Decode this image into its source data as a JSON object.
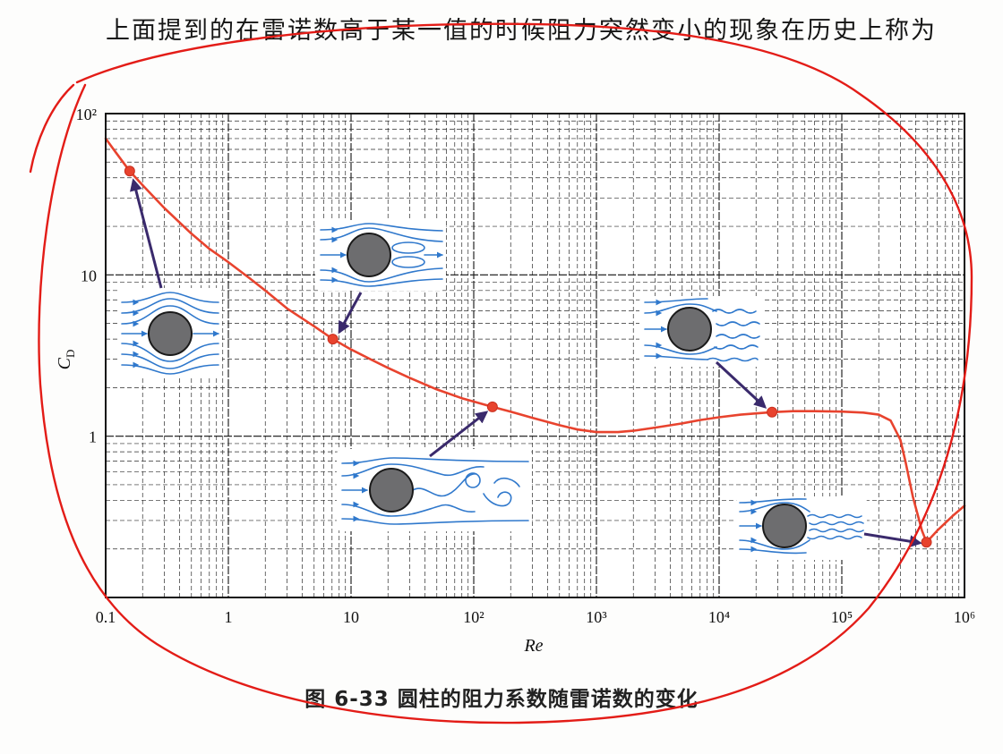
{
  "page": {
    "top_text": "上面提到的在雷诺数高于某一值的时候阻力突然变小的现象在历史上称为",
    "caption": "图 6-33  圆柱的阻力系数随雷诺数的变化"
  },
  "chart_data": {
    "type": "line",
    "xlabel": "Re",
    "ylabel": "C",
    "ylabel_subscript": "D",
    "xscale": "log",
    "yscale": "log",
    "xlim": [
      0.1,
      1000000
    ],
    "ylim": [
      0.1,
      100
    ],
    "grid": true,
    "x_ticks": [
      {
        "value": 0.1,
        "label": "0.1"
      },
      {
        "value": 1,
        "label": "1"
      },
      {
        "value": 10,
        "label": "10"
      },
      {
        "value": 100,
        "label": "10²"
      },
      {
        "value": 1000,
        "label": "10³"
      },
      {
        "value": 10000,
        "label": "10⁴"
      },
      {
        "value": 100000,
        "label": "10⁵"
      },
      {
        "value": 1000000,
        "label": "10⁶"
      }
    ],
    "y_ticks": [
      {
        "value": 1,
        "label": "1"
      },
      {
        "value": 10,
        "label": "10"
      },
      {
        "value": 100,
        "label": "10²"
      }
    ],
    "series": [
      {
        "color": "#e8432e",
        "x": [
          0.1,
          0.12,
          0.157,
          0.2,
          0.3,
          0.5,
          0.7,
          1,
          1.5,
          2,
          3,
          5,
          7.1,
          10,
          15,
          20,
          30,
          50,
          80,
          142,
          200,
          300,
          500,
          700,
          1000,
          1500,
          2000,
          3000,
          5000,
          7000,
          10000,
          15000,
          27000,
          40000,
          60000,
          100000,
          150000,
          200000,
          250000,
          300000,
          330000,
          380000,
          450000,
          490000,
          600000,
          800000,
          1000000
        ],
        "y": [
          70,
          58,
          44,
          36,
          26,
          18,
          14.5,
          12,
          9.5,
          8,
          6.2,
          4.8,
          4.0,
          3.45,
          2.95,
          2.65,
          2.3,
          1.95,
          1.72,
          1.52,
          1.42,
          1.3,
          1.17,
          1.1,
          1.06,
          1.06,
          1.08,
          1.13,
          1.2,
          1.26,
          1.31,
          1.36,
          1.41,
          1.43,
          1.43,
          1.42,
          1.4,
          1.36,
          1.25,
          0.95,
          0.7,
          0.42,
          0.26,
          0.22,
          0.26,
          0.32,
          0.37
        ]
      }
    ],
    "highlighted_points": {
      "color": "#e8432e",
      "x": [
        0.157,
        7.1,
        142,
        27000,
        490000
      ],
      "y": [
        44,
        4.0,
        1.52,
        1.41,
        0.22
      ]
    },
    "colors": {
      "streamlines": "#2f78cc",
      "cylinder": "#6d6d6f",
      "pointer_arrows": "#3a2a6c",
      "hand_annotation": "#e31c17"
    }
  }
}
